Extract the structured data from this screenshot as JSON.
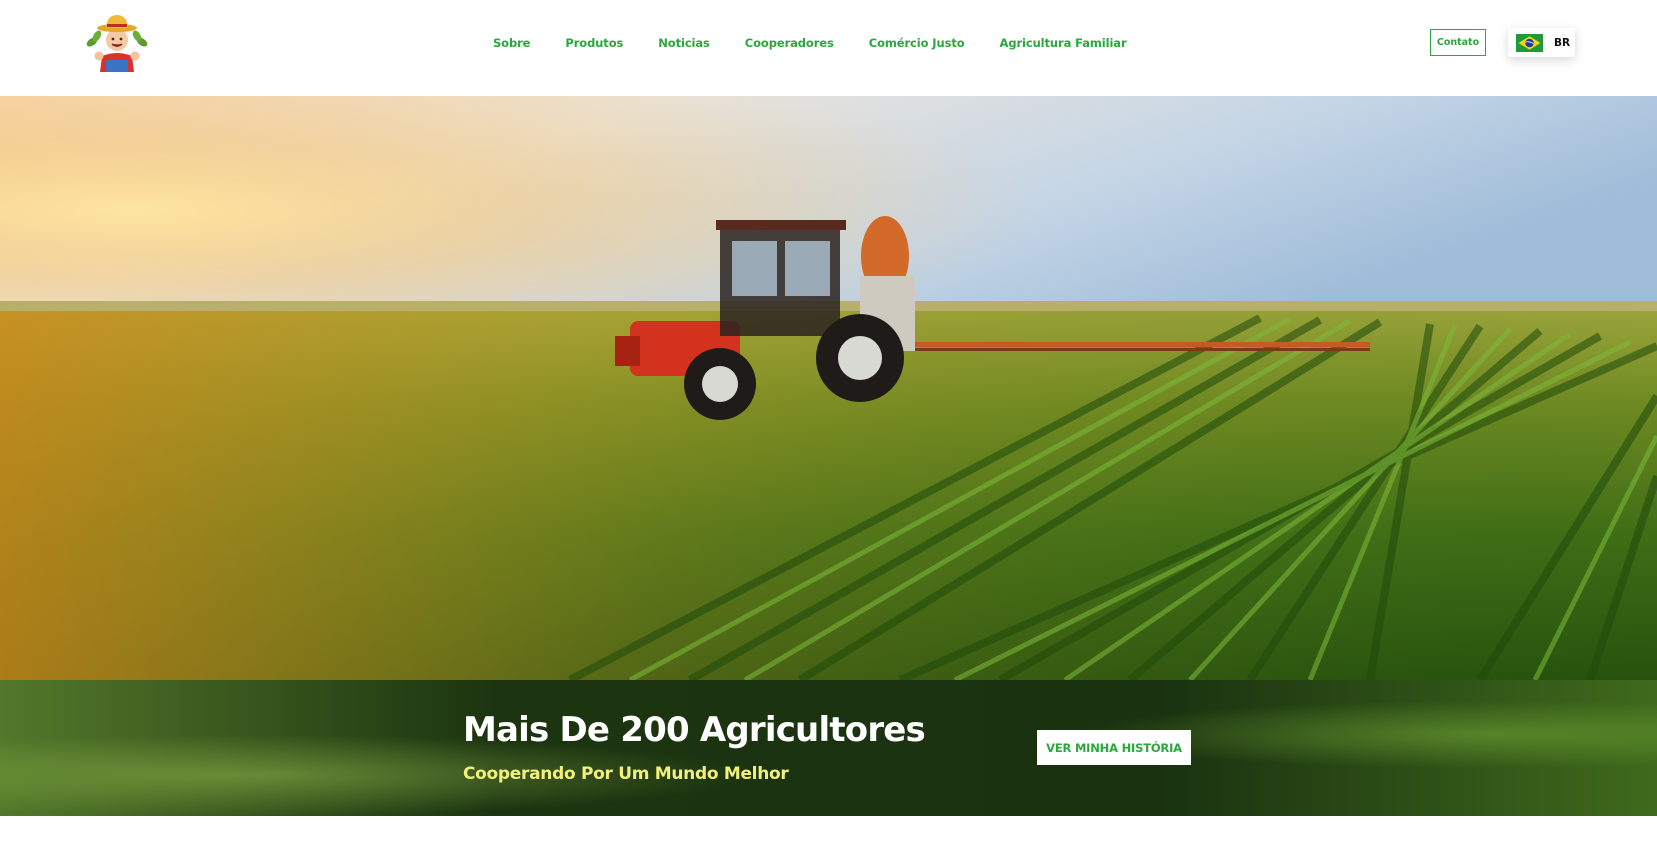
{
  "header": {
    "nav": [
      {
        "label": "Sobre"
      },
      {
        "label": "Produtos"
      },
      {
        "label": "Noticias"
      },
      {
        "label": "Cooperadores"
      },
      {
        "label": "Comércio Justo"
      },
      {
        "label": "Agricultura Familiar"
      }
    ],
    "contact_label": "Contato",
    "language": {
      "code": "BR",
      "flag": "brazil-flag-icon"
    }
  },
  "banner": {
    "headline": "Mais De 200 Agricultores",
    "subline": "Cooperando Por Um Mundo Melhor",
    "button_label": "VER MINHA HISTÓRIA"
  },
  "colors": {
    "accent_green": "#2aa73d",
    "subline_yellow": "#f3f07a",
    "banner_dark_green": "#1f3a12"
  }
}
